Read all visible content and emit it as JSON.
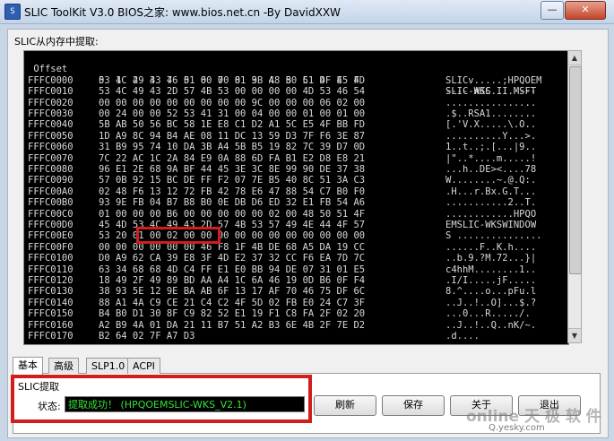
{
  "window": {
    "title": "SLIC ToolKit V3.0      BIOS之家: www.bios.net.cn    -By DavidXXW",
    "minimize_symbol": "—",
    "close_symbol": "✕",
    "icon": "app-icon"
  },
  "memory_group": {
    "label": "SLIC从内存中提取:"
  },
  "hex_view": {
    "header": {
      "offset": " Offset",
      "columns": "0  1  2  3  4  5  6  7  8  9  A  B  C  D  E  F",
      "ascii": "---- ASC II ----"
    },
    "rows": [
      {
        "addr": "FFFC0000",
        "bytes": "53 4C 49 43 76 01 00 00 01 3B 48 50 51 4F 45 4D",
        "ascii": "SLICv.....;HPQOEM"
      },
      {
        "addr": "FFFC0010",
        "bytes": "53 4C 49 43 2D 57 4B 53 00 00 00 00 4D 53 46 54",
        "ascii": "SLIC-WKS....MSFT"
      },
      {
        "addr": "FFFC0020",
        "bytes": "00 00 00 00 00 00 00 00 00 9C 00 00 00 06 02 00",
        "ascii": "................"
      },
      {
        "addr": "FFFC0030",
        "bytes": "00 24 00 00 52 53 41 31 00 04 00 00 01 00 01 00",
        "ascii": ".$..RSA1........"
      },
      {
        "addr": "FFFC0040",
        "bytes": "5B AB 50 56 BC 58 1E E8 C1 D2 A1 5C E5 4F BB FD",
        "ascii": "[.'V.X.....\\.O.."
      },
      {
        "addr": "FFFC0050",
        "bytes": "1D A9 8C 94 B4 AE 08 11 DC 13 59 D3 7F F6 3E 87",
        "ascii": "..........Y...>."
      },
      {
        "addr": "FFFC0060",
        "bytes": "31 B9 95 74 10 DA 3B A4 5B B5 19 82 7C 39 D7 0D",
        "ascii": "1..t..;.[...|9.."
      },
      {
        "addr": "FFFC0070",
        "bytes": "7C 22 AC 1C 2A 84 E9 0A 88 6D FA B1 E2 D8 E8 21",
        "ascii": "|\"..*....m.....!"
      },
      {
        "addr": "FFFC0080",
        "bytes": "96 E1 2E 68 9A BF 44 45 3E 3C 8E 99 90 DE 37 38",
        "ascii": "...h..DE><....78"
      },
      {
        "addr": "FFFC0090",
        "bytes": "57 0B 92 15 BC DE FF F2 07 7E B5 40 8C 51 3A C3",
        "ascii": "W........~.@.Q:."
      },
      {
        "addr": "FFFC00A0",
        "bytes": "02 48 F6 13 12 72 FB 42 78 E6 47 88 54 C7 B0 F0",
        "ascii": ".H...r.Bx.G.T..."
      },
      {
        "addr": "FFFC00B0",
        "bytes": "93 9E FB 04 B7 B8 B0 0E DB D6 ED 32 E1 FB 54 A6",
        "ascii": "...........2..T."
      },
      {
        "addr": "FFFC00C0",
        "bytes": "01 00 00 00 B6 00 00 00 00 00 02 00 48 50 51 4F",
        "ascii": "............HPQO"
      },
      {
        "addr": "FFFC00D0",
        "bytes": "45 4D 53 4C 49 43 2D 57 4B 53 57 49 4E 44 4F 57",
        "ascii": "EMSLIC-WKSWINDOW"
      },
      {
        "addr": "FFFC00E0",
        "bytes": "53 20 01 00 02 00 00 00 00 00 00 00 00 00 00 00",
        "ascii": "S ..............."
      },
      {
        "addr": "FFFC00F0",
        "bytes": "00 00 00 00 00 00 46 F8 1F 4B DE 68 A5 DA 19 CC",
        "ascii": "......F..K.h...."
      },
      {
        "addr": "FFFC0100",
        "bytes": "D0 A9 62 CA 39 E8 3F 4D E2 37 32 CC F6 EA 7D 7C",
        "ascii": "..b.9.?M.72...}|"
      },
      {
        "addr": "FFFC0110",
        "bytes": "63 34 68 68 4D C4 FF E1 E0 BB 94 DE 07 31 01 E5",
        "ascii": "c4hhM........1.."
      },
      {
        "addr": "FFFC0120",
        "bytes": "18 49 2F 49 89 BD AA A4 1C 6A 46 19 0D B6 0F F4",
        "ascii": ".I/I.....jF....."
      },
      {
        "addr": "FFFC0130",
        "bytes": "38 93 5E 12 9E BA AB 6F 13 17 AF 70 46 75 DF 6C",
        "ascii": "8.^....o...pFu.l"
      },
      {
        "addr": "FFFC0140",
        "bytes": "88 A1 4A C9 CE 21 C4 C2 4F 5D 02 FB E0 24 C7 3F",
        "ascii": "..J..!..O]...$.?"
      },
      {
        "addr": "FFFC0150",
        "bytes": "B4 B0 D1 30 8F C9 82 52 E1 19 F1 C8 FA 2F 02 20",
        "ascii": "...0...R...../. "
      },
      {
        "addr": "FFFC0160",
        "bytes": "A2 B9 4A 01 DA 21 11 B7 51 A2 B3 6E 4B 2F 7E D2",
        "ascii": "..J..!..Q..nK/~."
      },
      {
        "addr": "FFFC0170",
        "bytes": "B2 64 02 7F A7 D3",
        "ascii": ".d...."
      }
    ]
  },
  "tabs": [
    {
      "label": "基本"
    },
    {
      "label": "高级"
    },
    {
      "label": "SLP1.0"
    },
    {
      "label": "ACPI"
    }
  ],
  "slic_section": {
    "title": "SLIC提取",
    "status_label": "状态:",
    "status_value": "提取成功！ (HPQOEMSLIC-WKS_V2.1)"
  },
  "buttons": {
    "refresh": "刷新",
    "save": "保存",
    "about": "关于",
    "exit": "退出"
  },
  "watermark": {
    "line1": "online 天 极 软 件",
    "line2": "Q.yesky.com"
  }
}
